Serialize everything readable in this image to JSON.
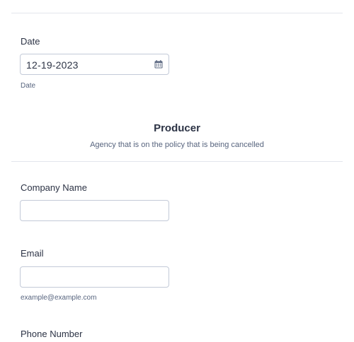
{
  "date_field": {
    "label": "Date",
    "value": "12-19-2023",
    "sublabel": "Date",
    "icon": "calendar-icon"
  },
  "section": {
    "title": "Producer",
    "subtitle": "Agency that is on the policy that is being cancelled"
  },
  "company_field": {
    "label": "Company Name",
    "value": ""
  },
  "email_field": {
    "label": "Email",
    "value": "",
    "sublabel": "example@example.com"
  },
  "phone_field": {
    "label": "Phone Number"
  }
}
